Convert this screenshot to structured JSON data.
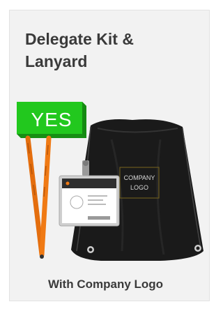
{
  "card": {
    "title": "Delegate Kit & Lanyard",
    "badge": "YES",
    "bag_logo_line1": "COMPANY",
    "bag_logo_line2": "LOGO",
    "caption": "With Company Logo"
  },
  "colors": {
    "card_background": "#f2f2f2",
    "badge_green": "#22c81e",
    "lanyard_orange": "#f07a14",
    "bag_black": "#1a1a1a",
    "text_dark": "#3a3a3a"
  },
  "icons": {
    "badge": "yes-badge-icon",
    "lanyard": "lanyard-icon",
    "id_card": "id-card-icon",
    "bag": "drawstring-bag-icon"
  }
}
